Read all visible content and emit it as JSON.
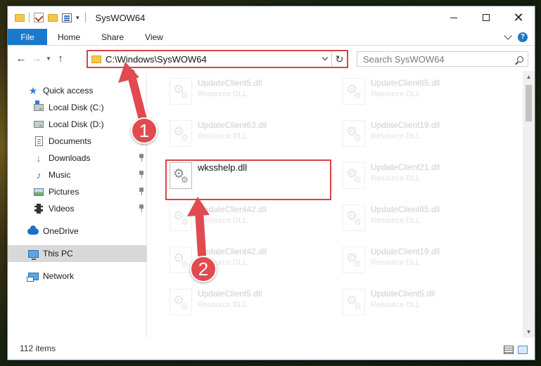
{
  "window": {
    "title": "SysWOW64"
  },
  "ribbon": {
    "tabs": [
      "File",
      "Home",
      "Share",
      "View"
    ],
    "help": "?"
  },
  "nav": {
    "address": "C:\\Windows\\SysWOW64",
    "search_placeholder": "Search SysWOW64"
  },
  "sidebar": {
    "items": [
      {
        "label": "Quick access",
        "icon": "star-icon",
        "pinned": false
      },
      {
        "label": "Local Disk (C:)",
        "icon": "drive-c-icon",
        "pinned": true
      },
      {
        "label": "Local Disk (D:)",
        "icon": "drive-icon",
        "pinned": false
      },
      {
        "label": "Documents",
        "icon": "documents-icon",
        "pinned": true
      },
      {
        "label": "Downloads",
        "icon": "downloads-icon",
        "pinned": true
      },
      {
        "label": "Music",
        "icon": "music-icon",
        "pinned": true
      },
      {
        "label": "Pictures",
        "icon": "pictures-icon",
        "pinned": true
      },
      {
        "label": "Videos",
        "icon": "videos-icon",
        "pinned": true
      },
      {
        "label": "OneDrive",
        "icon": "onedrive-icon",
        "pinned": false
      },
      {
        "label": "This PC",
        "icon": "this-pc-icon",
        "pinned": false,
        "selected": true
      },
      {
        "label": "Network",
        "icon": "network-icon",
        "pinned": false
      }
    ]
  },
  "files": {
    "left": [
      {
        "name": "UpdateClient5.dll",
        "type": "Resource DLL"
      },
      {
        "name": "UpdateClient63.dll",
        "type": "Resource DLL"
      },
      {
        "name": "wksshelp.dll",
        "type": ""
      },
      {
        "name": "UpdateClient42.dll",
        "type": "Resource DLL"
      },
      {
        "name": "UpdateClient42.dll",
        "type": "Resource DLL"
      },
      {
        "name": "UpdateClient5.dll",
        "type": "Resource DLL"
      }
    ],
    "right": [
      {
        "name": "UpdateClient65.dll",
        "type": "Resource DLL"
      },
      {
        "name": "UpdateClient19.dll",
        "type": "Resource DLL"
      },
      {
        "name": "UpdateClient21.dll",
        "type": "Resource DLL"
      },
      {
        "name": "UpdateClient65.dll",
        "type": "Resource DLL"
      },
      {
        "name": "UpdateClient19.dll",
        "type": "Resource DLL"
      },
      {
        "name": "UpdateClient5.dll",
        "type": "Resource DLL"
      }
    ]
  },
  "status": {
    "item_count": "112 items"
  },
  "annotations": {
    "step1": "1",
    "step2": "2",
    "color": "#e14a4f"
  },
  "colors": {
    "accent": "#1979ca",
    "highlight": "#d9434a"
  }
}
